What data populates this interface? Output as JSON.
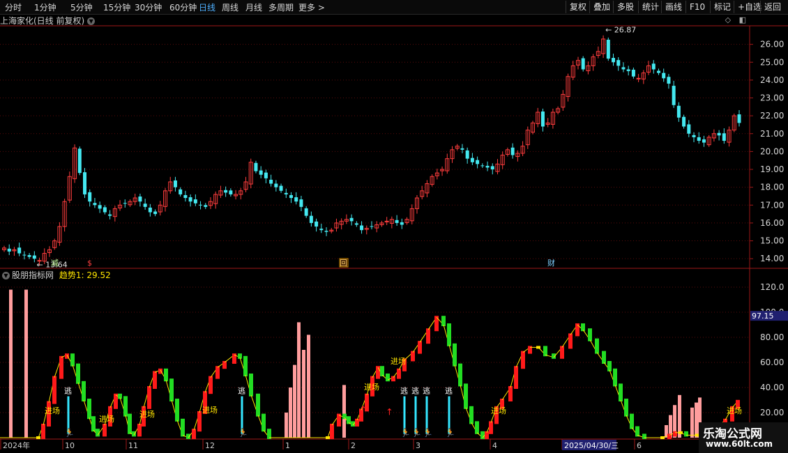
{
  "toolbar": {
    "periods": [
      "分时",
      "1分钟",
      "5分钟",
      "15分钟",
      "30分钟",
      "60分钟",
      "日线",
      "周线",
      "月线",
      "多周期",
      "更多 >"
    ],
    "active_period": "日线",
    "right_buttons": [
      "复权",
      "叠加",
      "多股",
      "统计",
      "画线",
      "F10",
      "标记",
      "+自选",
      "返回"
    ]
  },
  "main_chart": {
    "title": "上海家化(日线 前复权)",
    "high_label": "26.87",
    "low_label": "13.64",
    "price_ticks": [
      "26.00",
      "25.00",
      "24.00",
      "23.00",
      "22.00",
      "21.00",
      "20.00",
      "19.00",
      "18.00",
      "17.00",
      "16.00",
      "15.00",
      "14.00"
    ],
    "markers": [
      "减",
      "$",
      "回",
      "财"
    ]
  },
  "indicator": {
    "name": "股朋指标网",
    "series_label": "趋势1:",
    "series_value": "29.52",
    "ticks": [
      "120.0",
      "100.0",
      "80.00",
      "60.00",
      "40.00",
      "20.00"
    ],
    "current_tag": "97.15",
    "enter_label": "进场",
    "escape_label": "逃"
  },
  "time_axis": [
    "2024年",
    "10",
    "11",
    "12",
    "1",
    "2",
    "3",
    "4",
    "2025/04/30/三",
    "6"
  ],
  "watermark": {
    "line1": "乐淘公式网",
    "line2": "www.60lt.com"
  },
  "colors": {
    "up": "#ff3d3d",
    "down": "#44e8f0",
    "axis": "#a01818",
    "curve_up": "#ff1a1a",
    "curve_down": "#22dd22",
    "pink": "#ff9d9d",
    "yellow": "#ffe600"
  },
  "chart_data": {
    "type": "candlestick",
    "close": [
      14.6,
      14.4,
      14.5,
      14.3,
      14.2,
      14.1,
      14.0,
      13.9,
      14.3,
      14.5,
      15.0,
      15.8,
      17.2,
      18.6,
      20.2,
      18.8,
      17.6,
      17.2,
      17.0,
      16.8,
      16.6,
      16.4,
      16.8,
      17.0,
      17.1,
      17.2,
      17.4,
      17.2,
      16.9,
      16.6,
      16.5,
      17.0,
      17.8,
      18.3,
      18.0,
      17.6,
      17.4,
      17.2,
      17.1,
      17.0,
      16.9,
      17.2,
      17.6,
      17.8,
      17.7,
      17.6,
      17.6,
      17.8,
      18.3,
      19.4,
      18.9,
      18.7,
      18.5,
      18.2,
      18.0,
      17.8,
      17.6,
      17.4,
      17.2,
      16.9,
      16.4,
      16.0,
      15.8,
      15.6,
      15.5,
      15.6,
      16.0,
      16.1,
      16.2,
      16.1,
      15.9,
      15.6,
      15.7,
      15.8,
      15.9,
      16.0,
      16.1,
      16.2,
      16.0,
      15.9,
      16.2,
      16.8,
      17.4,
      17.8,
      18.2,
      18.6,
      18.8,
      19.0,
      19.6,
      20.1,
      20.3,
      20.1,
      19.6,
      19.4,
      19.3,
      19.2,
      19.1,
      19.0,
      19.3,
      19.8,
      20.1,
      19.8,
      19.9,
      20.3,
      21.2,
      21.6,
      22.2,
      21.4,
      21.6,
      22.2,
      22.4,
      23.2,
      24.2,
      24.8,
      25.1,
      24.6,
      24.8,
      25.3,
      25.6,
      26.3,
      25.2,
      25.0,
      24.8,
      24.6,
      24.5,
      24.2,
      24.1,
      24.4,
      24.8,
      24.6,
      24.4,
      24.1,
      23.8,
      22.6,
      21.9,
      21.4,
      21.0,
      20.8,
      20.6,
      20.5,
      20.8,
      21.0,
      20.9,
      20.6,
      21.2,
      22.0,
      21.6
    ],
    "y_range": [
      13.5,
      27.0
    ],
    "indicator_range": [
      0,
      125
    ],
    "indicator_last": 29.52
  }
}
